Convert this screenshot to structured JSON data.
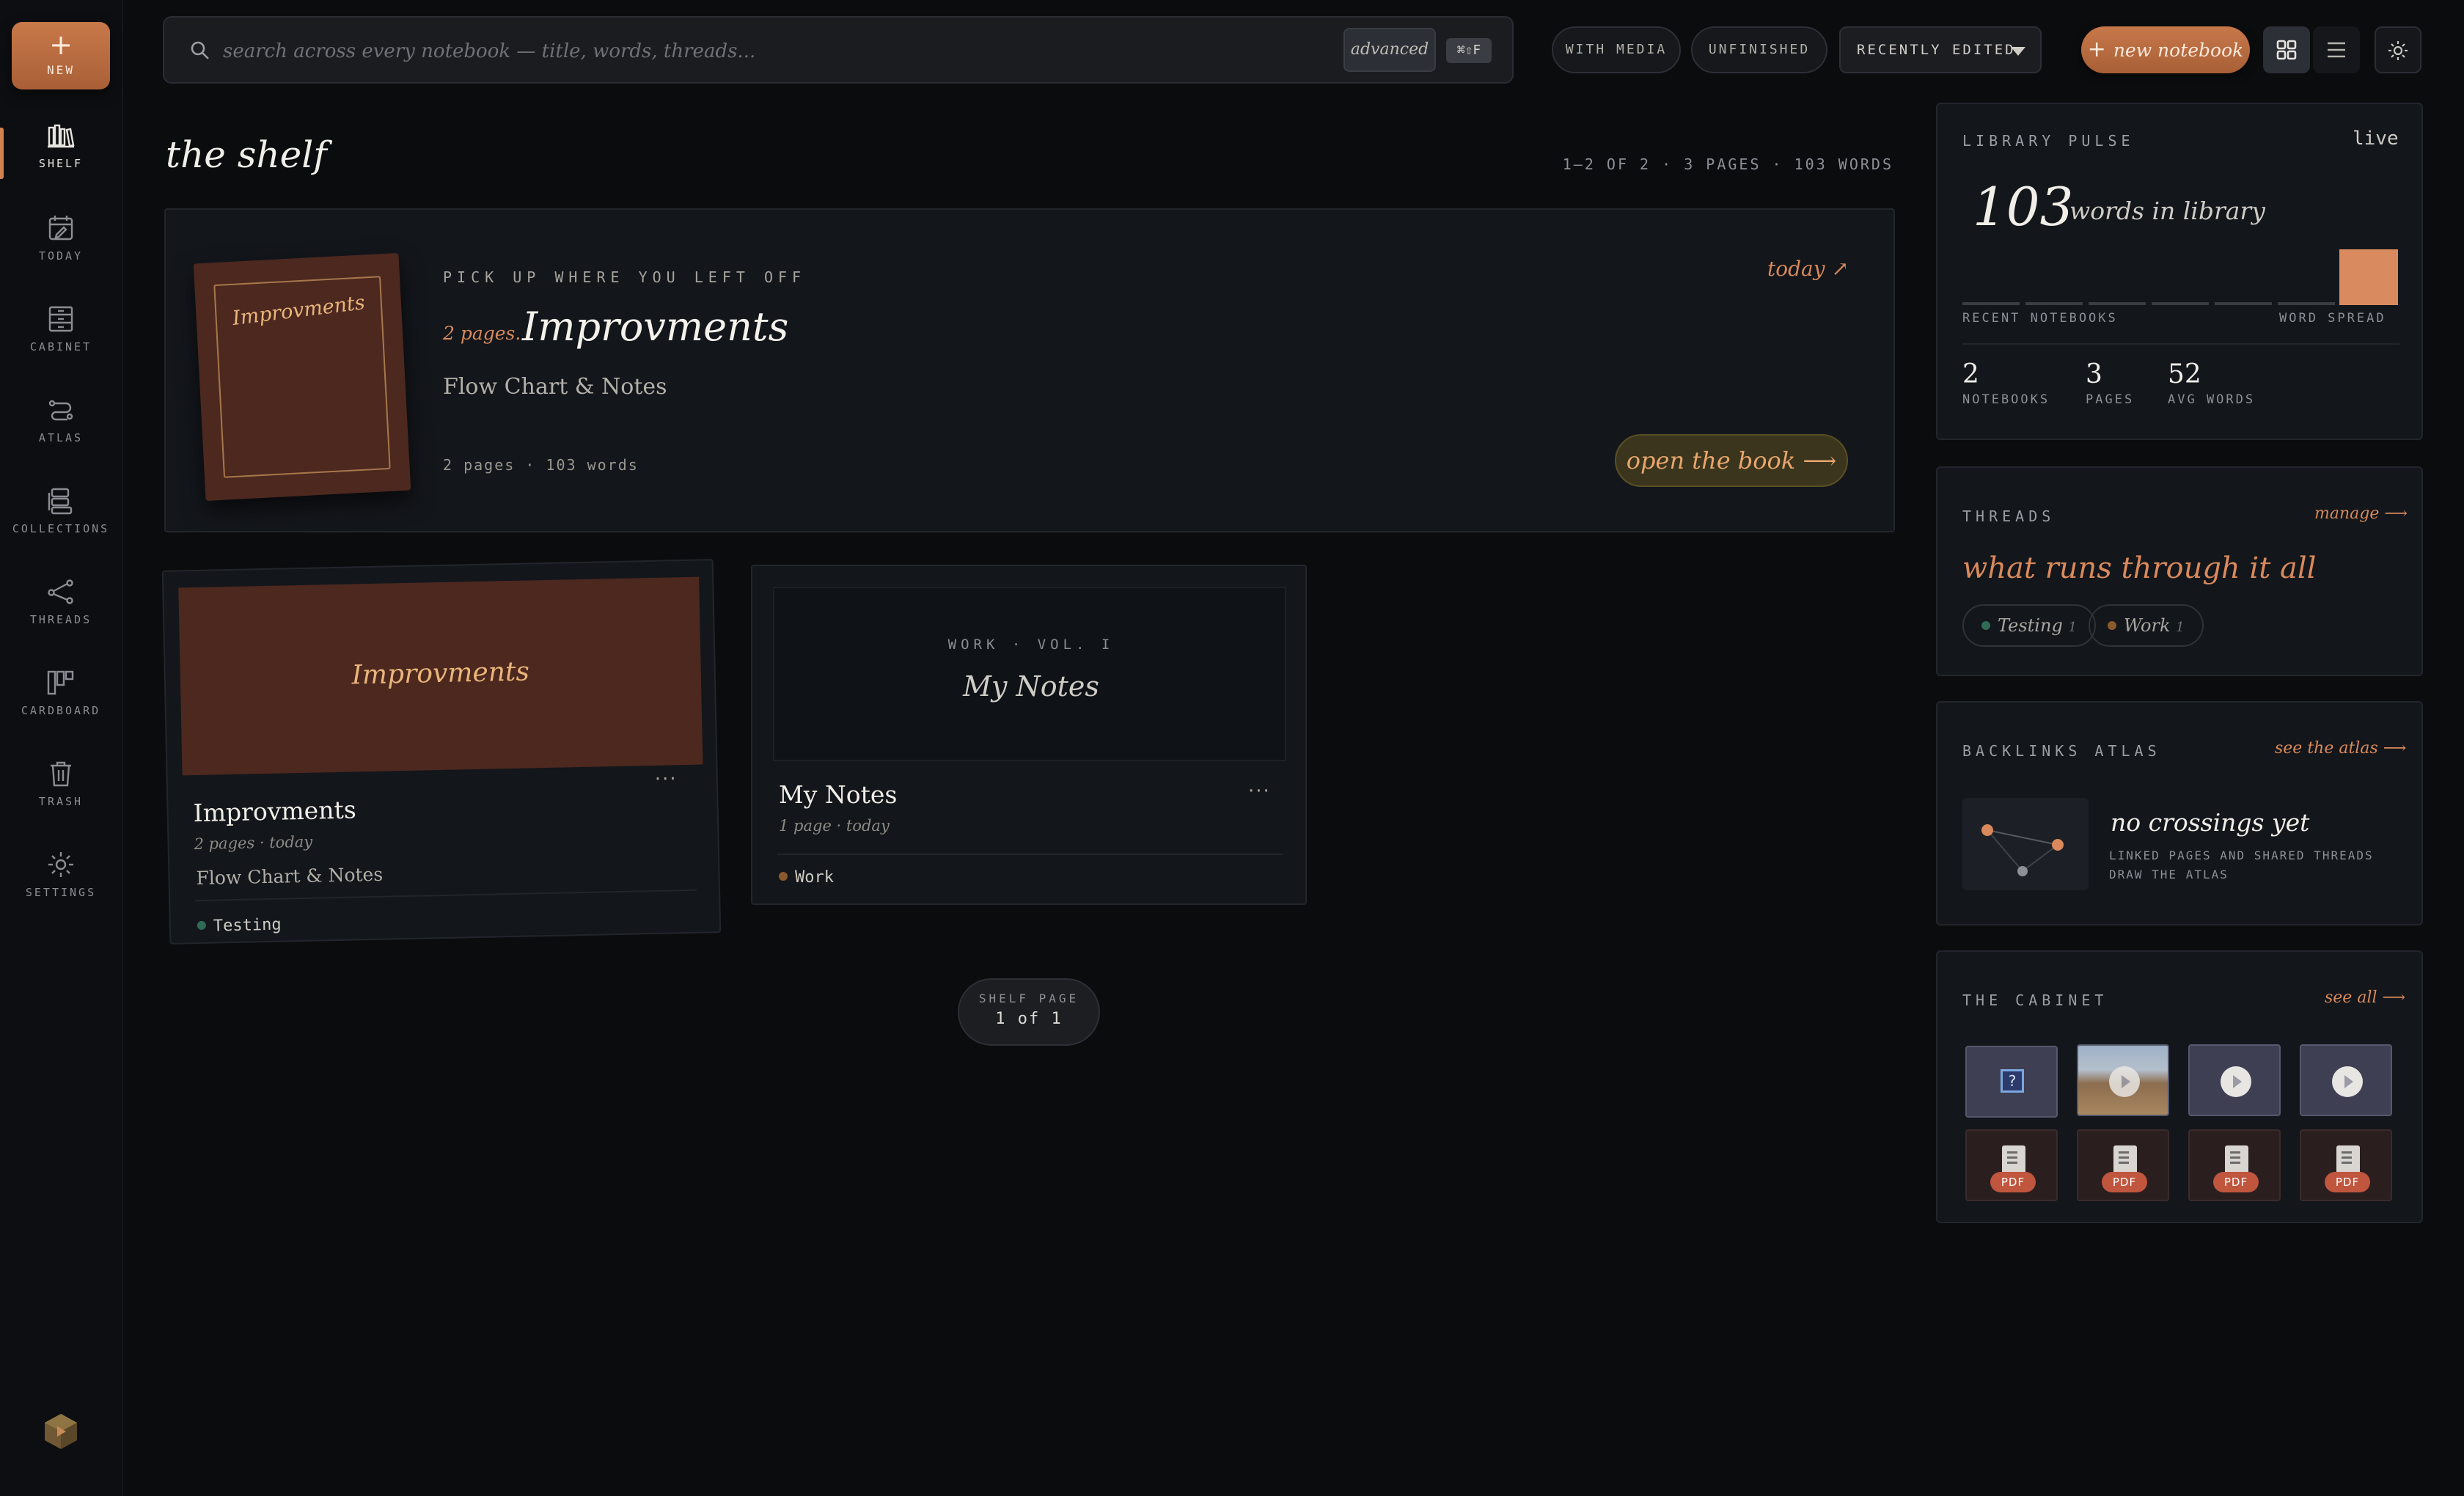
{
  "sidebar": {
    "new_label": "NEW",
    "items": [
      {
        "label": "SHELF",
        "icon": "shelf-icon",
        "active": true
      },
      {
        "label": "TODAY",
        "icon": "calendar-icon"
      },
      {
        "label": "CABINET",
        "icon": "cabinet-icon"
      },
      {
        "label": "ATLAS",
        "icon": "atlas-icon"
      },
      {
        "label": "COLLECTIONS",
        "icon": "collections-icon"
      },
      {
        "label": "THREADS",
        "icon": "threads-icon"
      },
      {
        "label": "CARDBOARD",
        "icon": "cardboard-icon"
      },
      {
        "label": "TRASH",
        "icon": "trash-icon"
      },
      {
        "label": "SETTINGS",
        "icon": "settings-icon"
      }
    ]
  },
  "toolbar": {
    "search_placeholder": "search across every notebook — title, words, threads...",
    "advanced_label": "advanced",
    "shortcut": "⌘⇧F",
    "filter_media": "WITH MEDIA",
    "filter_unfinished": "UNFINISHED",
    "sort_value": "RECENTLY EDITED",
    "new_notebook": "new notebook"
  },
  "shelf": {
    "title": "the shelf",
    "stats": "1–2 OF 2 · 3 PAGES · 103 WORDS"
  },
  "hero": {
    "kicker": "PICK UP WHERE YOU LEFT OFF",
    "pages": "2 pages.",
    "title": "Improvments",
    "cover_title": "Improvments",
    "description": "Flow Chart & Notes",
    "meta": "2 pages · 103 words",
    "when": "today ↗",
    "open_label": "open the book ⟶"
  },
  "notebooks": [
    {
      "cover_title": "Improvments",
      "name": "Improvments",
      "sub": "2 pages · today",
      "description": "Flow Chart & Notes",
      "tag": "Testing",
      "tag_color": "#2f6b55"
    },
    {
      "cover_kicker": "WORK · VOL. I",
      "cover_title": "My Notes",
      "name": "My Notes",
      "sub": "1 page · today",
      "tag": "Work",
      "tag_color": "#8a5a2c"
    }
  ],
  "pager": {
    "label": "SHELF PAGE",
    "value": "1 of 1"
  },
  "pulse": {
    "kicker": "LIBRARY PULSE",
    "live": "live",
    "words": "103",
    "words_label": "words in library",
    "spark_left": "RECENT NOTEBOOKS",
    "spark_right": "WORD SPREAD",
    "stats": [
      {
        "value": "2",
        "label": "NOTEBOOKS"
      },
      {
        "value": "3",
        "label": "PAGES"
      },
      {
        "value": "52",
        "label": "AVG WORDS"
      }
    ]
  },
  "threads": {
    "kicker": "THREADS",
    "manage": "manage ⟶",
    "headline": "what runs through it all",
    "items": [
      {
        "name": "Testing",
        "count": "1",
        "color": "#2f6b55"
      },
      {
        "name": "Work",
        "count": "1",
        "color": "#8a5a2c"
      }
    ]
  },
  "atlas": {
    "kicker": "BACKLINKS ATLAS",
    "link": "see the atlas ⟶",
    "headline": "no crossings yet",
    "subline": "LINKED PAGES AND SHARED THREADS DRAW THE ATLAS"
  },
  "cabinet": {
    "kicker": "THE CABINET",
    "link": "see all ⟶",
    "pdf_label": "PDF"
  },
  "colors": {
    "accent": "#c8794a",
    "accent_text": "#d7895a",
    "cover": "#4c281f"
  }
}
